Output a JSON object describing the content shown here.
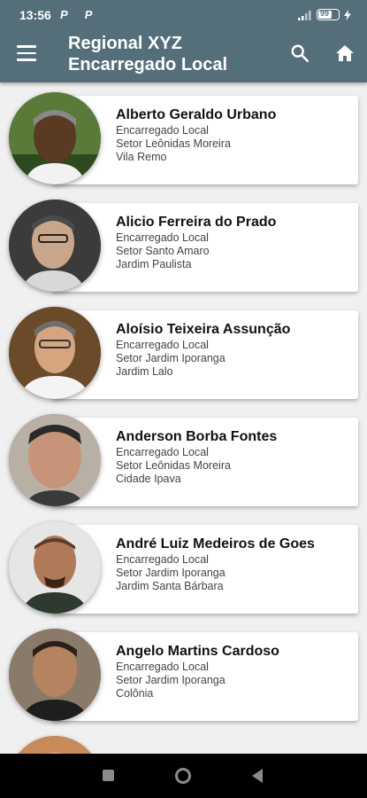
{
  "status_bar": {
    "time": "13:56",
    "notifications": "P P",
    "battery": "99"
  },
  "app_bar": {
    "title_line1": "Regional XYZ",
    "title_line2": "Encarregado Local"
  },
  "people": [
    {
      "name": "Alberto Geraldo Urbano",
      "role": "Encarregado Local",
      "sector": "Setor Leônidas Moreira",
      "area": "Vila Remo"
    },
    {
      "name": "Alicio Ferreira do Prado",
      "role": "Encarregado Local",
      "sector": "Setor Santo Amaro",
      "area": "Jardim Paulista"
    },
    {
      "name": "Aloísio Teixeira Assunção",
      "role": "Encarregado Local",
      "sector": "Setor Jardim Iporanga",
      "area": "Jardim Lalo"
    },
    {
      "name": "Anderson Borba Fontes",
      "role": "Encarregado Local",
      "sector": "Setor Leônidas Moreira",
      "area": "Cidade Ipava"
    },
    {
      "name": "André Luiz Medeiros de Goes",
      "role": "Encarregado Local",
      "sector": "Setor Jardim Iporanga",
      "area": "Jardim Santa Bárbara"
    },
    {
      "name": "Angelo Martins Cardoso",
      "role": "Encarregado Local",
      "sector": "Setor Jardim Iporanga",
      "area": "Colônia"
    }
  ],
  "colors": {
    "app_bar": "#546e7a",
    "card_bg": "#ffffff",
    "page_bg": "#f0f0f0"
  },
  "icons": [
    "menu-icon",
    "search-icon",
    "home-icon",
    "signal-icon",
    "battery-icon",
    "nav-recents-icon",
    "nav-home-icon",
    "nav-back-icon"
  ]
}
